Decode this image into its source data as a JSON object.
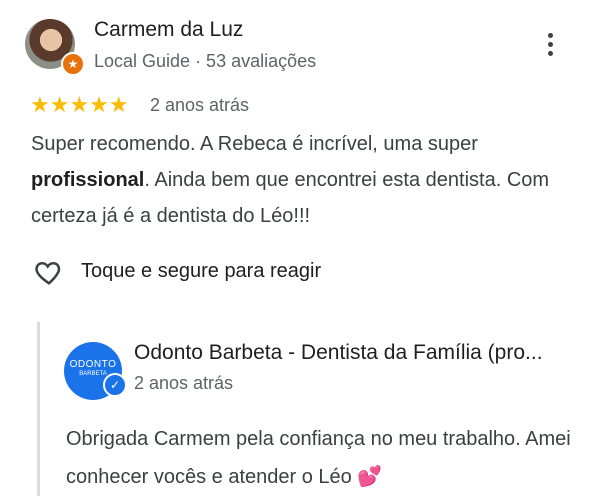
{
  "review": {
    "author": "Carmem da Luz",
    "author_meta": "Local Guide · 53 avaliações",
    "stars": "★★★★★",
    "rating": 5,
    "date": "2 anos atrás",
    "text_part1": "Super recomendo. A Rebeca é incrível, uma super ",
    "text_bold": "profissional",
    "text_part2": ". Ainda bem que encontrei esta dentista. Com certeza já é a dentista do Léo!!!",
    "react_label": "Toque e segure para reagir"
  },
  "reply": {
    "business_name": "Odonto Barbeta - Dentista da Família (pro...",
    "logo_line1": "ODONTO",
    "logo_line2": "BARBETA",
    "date": "2 anos atrás",
    "text": "Obrigada Carmem pela confiança no meu trabalho. Amei conhecer vocês e atender o Léo ",
    "emoji": "💕"
  },
  "colors": {
    "star": "#fbbc04",
    "local_guide_badge": "#e8710a",
    "business_blue": "#1a73e8"
  },
  "icons": [
    "more-vert-icon",
    "star-icon",
    "heart-outline-icon",
    "verified-check-icon",
    "local-guide-icon"
  ]
}
